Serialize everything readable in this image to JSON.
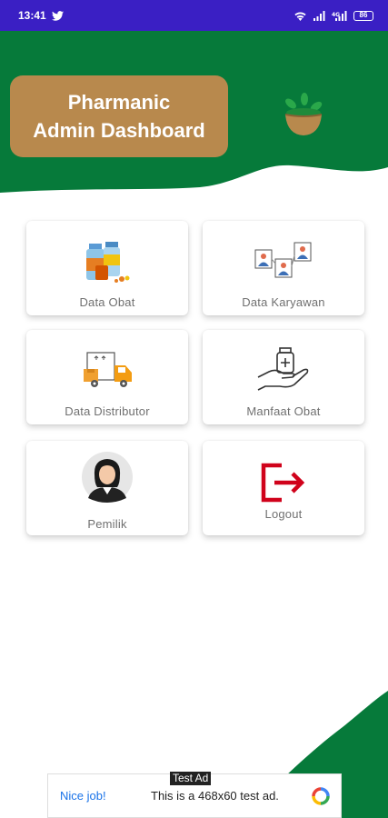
{
  "status_bar": {
    "time": "13:41",
    "battery": "86"
  },
  "header": {
    "title_line1": "Pharmanic",
    "title_line2": "Admin Dashboard"
  },
  "menu": {
    "data_obat": "Data Obat",
    "data_karyawan": "Data Karyawan",
    "data_distributor": "Data Distributor",
    "manfaat_obat": "Manfaat Obat",
    "pemilik": "Pemilik",
    "logout": "Logout"
  },
  "ad": {
    "tag": "Test Ad",
    "nice": "Nice job!",
    "text": "This is a 468x60 test ad."
  },
  "colors": {
    "status_bar": "#3a1fc4",
    "brand_green": "#067a3a",
    "title_card": "#b8894d",
    "logout_red": "#d0021b"
  }
}
